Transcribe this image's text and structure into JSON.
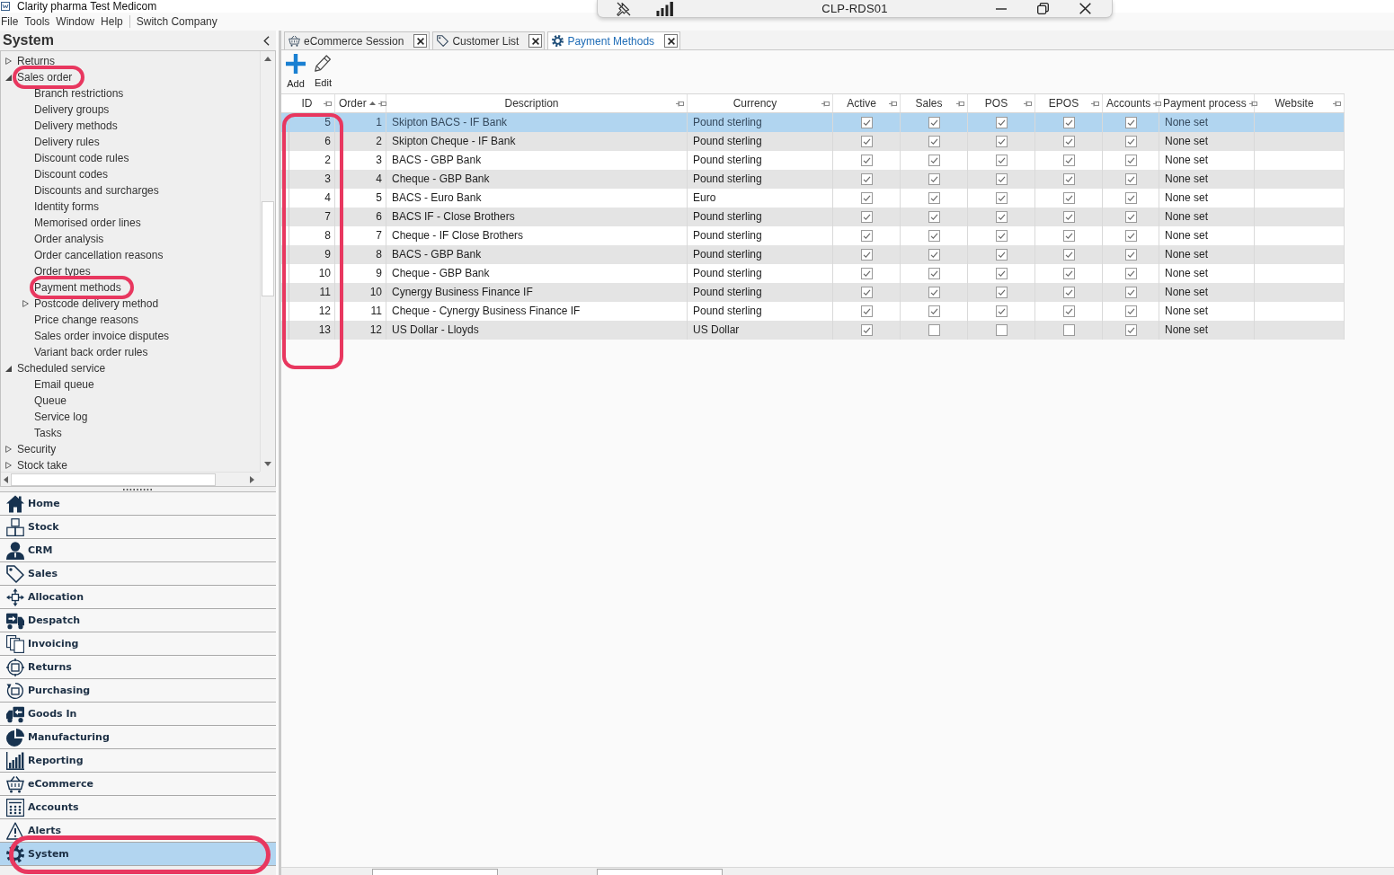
{
  "window": {
    "title": "Clarity pharma Test Medicom"
  },
  "remote_session_bar": {
    "title": "CLP-RDS01"
  },
  "menu": [
    "File",
    "Tools",
    "Window",
    "Help"
  ],
  "menu_commands": [
    "Switch Company"
  ],
  "sidebar": {
    "title": "System",
    "tree": [
      {
        "label": "Returns",
        "expanded": false,
        "circled": false
      },
      {
        "label": "Sales order",
        "expanded": true,
        "circled": true,
        "children": [
          {
            "label": "Branch restrictions",
            "circled": false
          },
          {
            "label": "Delivery groups",
            "circled": false
          },
          {
            "label": "Delivery methods",
            "circled": false
          },
          {
            "label": "Delivery rules",
            "circled": false
          },
          {
            "label": "Discount code rules",
            "circled": false
          },
          {
            "label": "Discount codes",
            "circled": false
          },
          {
            "label": "Discounts and surcharges",
            "circled": false
          },
          {
            "label": "Identity forms",
            "circled": false
          },
          {
            "label": "Memorised order lines",
            "circled": false
          },
          {
            "label": "Order analysis",
            "circled": false
          },
          {
            "label": "Order cancellation reasons",
            "circled": false
          },
          {
            "label": "Order types",
            "circled": false
          },
          {
            "label": "Payment methods",
            "circled": true
          },
          {
            "label": "Postcode delivery method",
            "expanded": false,
            "circled": false
          },
          {
            "label": "Price change reasons",
            "circled": false
          },
          {
            "label": "Sales order invoice disputes",
            "circled": false
          },
          {
            "label": "Variant back order rules",
            "circled": false
          }
        ]
      },
      {
        "label": "Scheduled service",
        "expanded": true,
        "circled": false,
        "children": [
          {
            "label": "Email queue",
            "circled": false
          },
          {
            "label": "Queue",
            "circled": false
          },
          {
            "label": "Service log",
            "circled": false
          },
          {
            "label": "Tasks",
            "circled": false
          }
        ]
      },
      {
        "label": "Security",
        "expanded": false,
        "circled": false
      },
      {
        "label": "Stock take",
        "expanded": false,
        "circled": false
      }
    ],
    "nav": [
      {
        "label": "Home",
        "selected": false,
        "circled": false
      },
      {
        "label": "Stock",
        "selected": false,
        "circled": false
      },
      {
        "label": "CRM",
        "selected": false,
        "circled": false
      },
      {
        "label": "Sales",
        "selected": false,
        "circled": false
      },
      {
        "label": "Allocation",
        "selected": false,
        "circled": false
      },
      {
        "label": "Despatch",
        "selected": false,
        "circled": false
      },
      {
        "label": "Invoicing",
        "selected": false,
        "circled": false
      },
      {
        "label": "Returns",
        "selected": false,
        "circled": false
      },
      {
        "label": "Purchasing",
        "selected": false,
        "circled": false
      },
      {
        "label": "Goods In",
        "selected": false,
        "circled": false
      },
      {
        "label": "Manufacturing",
        "selected": false,
        "circled": false
      },
      {
        "label": "Reporting",
        "selected": false,
        "circled": false
      },
      {
        "label": "eCommerce",
        "selected": false,
        "circled": false
      },
      {
        "label": "Accounts",
        "selected": false,
        "circled": false
      },
      {
        "label": "Alerts",
        "selected": false,
        "circled": false
      },
      {
        "label": "System",
        "selected": true,
        "circled": true
      }
    ]
  },
  "tabs": [
    {
      "label": "eCommerce Session",
      "selected": false
    },
    {
      "label": "Customer List",
      "selected": false
    },
    {
      "label": "Payment Methods",
      "selected": true
    }
  ],
  "toolbar": [
    "Add",
    "Edit"
  ],
  "table": {
    "columns": [
      {
        "label": "ID",
        "kind": "number",
        "sorted": false,
        "circled": true
      },
      {
        "label": "Order",
        "kind": "number",
        "sorted": true,
        "circled": false
      },
      {
        "label": "Description",
        "kind": "text",
        "sorted": false,
        "circled": false
      },
      {
        "label": "Currency",
        "kind": "text",
        "sorted": false,
        "circled": false
      },
      {
        "label": "Active",
        "kind": "check",
        "sorted": false,
        "circled": false
      },
      {
        "label": "Sales",
        "kind": "check",
        "sorted": false,
        "circled": false
      },
      {
        "label": "POS",
        "kind": "check",
        "sorted": false,
        "circled": false
      },
      {
        "label": "EPOS",
        "kind": "check",
        "sorted": false,
        "circled": false
      },
      {
        "label": "Accounts",
        "kind": "check",
        "sorted": false,
        "circled": false
      },
      {
        "label": "Payment process",
        "kind": "text",
        "sorted": false,
        "circled": false
      },
      {
        "label": "Website",
        "kind": "text",
        "sorted": false,
        "circled": false
      }
    ],
    "rows": [
      {
        "selected": true,
        "cells": [
          "5",
          "1",
          "Skipton BACS - IF Bank",
          "Pound sterling",
          true,
          true,
          true,
          true,
          true,
          "None set"
        ]
      },
      {
        "selected": false,
        "cells": [
          "6",
          "2",
          "Skipton Cheque - IF Bank",
          "Pound sterling",
          true,
          true,
          true,
          true,
          true,
          "None set"
        ]
      },
      {
        "selected": false,
        "cells": [
          "2",
          "3",
          "BACS - GBP Bank",
          "Pound sterling",
          true,
          true,
          true,
          true,
          true,
          "None set"
        ]
      },
      {
        "selected": false,
        "cells": [
          "3",
          "4",
          "Cheque - GBP Bank",
          "Pound sterling",
          true,
          true,
          true,
          true,
          true,
          "None set"
        ]
      },
      {
        "selected": false,
        "cells": [
          "4",
          "5",
          "BACS - Euro Bank",
          "Euro",
          true,
          true,
          true,
          true,
          true,
          "None set"
        ]
      },
      {
        "selected": false,
        "cells": [
          "7",
          "6",
          "BACS IF - Close Brothers",
          "Pound sterling",
          true,
          true,
          true,
          true,
          true,
          "None set"
        ]
      },
      {
        "selected": false,
        "cells": [
          "8",
          "7",
          "Cheque - IF Close Brothers",
          "Pound sterling",
          true,
          true,
          true,
          true,
          true,
          "None set"
        ]
      },
      {
        "selected": false,
        "cells": [
          "9",
          "8",
          "BACS - GBP Bank",
          "Pound sterling",
          true,
          true,
          true,
          true,
          true,
          "None set"
        ]
      },
      {
        "selected": false,
        "cells": [
          "10",
          "9",
          "Cheque - GBP Bank",
          "Pound sterling",
          true,
          true,
          true,
          true,
          true,
          "None set"
        ]
      },
      {
        "selected": false,
        "cells": [
          "11",
          "10",
          "Cynergy Business Finance IF",
          "Pound sterling",
          true,
          true,
          true,
          true,
          true,
          "None set"
        ]
      },
      {
        "selected": false,
        "cells": [
          "12",
          "11",
          "Cheque - Cynergy Business Finance IF",
          "Pound sterling",
          true,
          true,
          true,
          true,
          true,
          "None set"
        ]
      },
      {
        "selected": false,
        "cells": [
          "13",
          "12",
          "US Dollar - Lloyds",
          "US Dollar",
          true,
          false,
          false,
          false,
          true,
          "None set"
        ]
      }
    ]
  }
}
